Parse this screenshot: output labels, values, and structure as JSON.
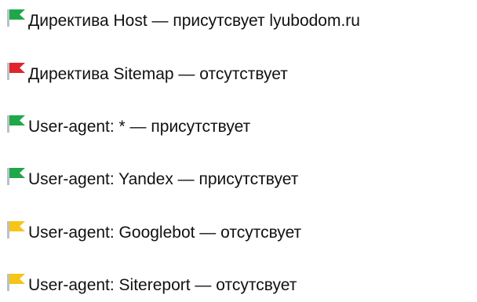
{
  "checks": [
    {
      "text": "Директива Host — присутсвует lyubodom.ru",
      "status": "ok",
      "flag_color": "#1fa84a",
      "icon": "green-flag-icon"
    },
    {
      "text": "Директива Sitemap — отсутствует",
      "status": "error",
      "flag_color": "#e0242b",
      "icon": "red-flag-icon"
    },
    {
      "text": "User-agent: * — присутствует",
      "status": "ok",
      "flag_color": "#1fa84a",
      "icon": "green-flag-icon"
    },
    {
      "text": "User-agent: Yandex — присутствует",
      "status": "ok",
      "flag_color": "#1fa84a",
      "icon": "green-flag-icon"
    },
    {
      "text": "User-agent: Googlebot — отсутсвует",
      "status": "warning",
      "flag_color": "#f5c518",
      "icon": "yellow-flag-icon"
    },
    {
      "text": "User-agent: Sitereport — отсутсвует",
      "status": "warning",
      "flag_color": "#f5c518",
      "icon": "yellow-flag-icon"
    }
  ]
}
